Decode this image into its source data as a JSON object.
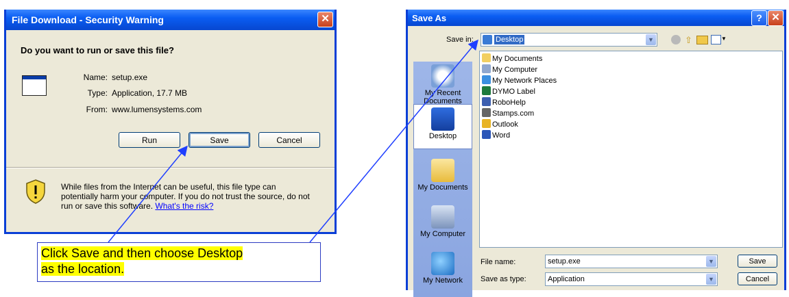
{
  "file_download": {
    "title": "File Download - Security Warning",
    "question": "Do you want to run or save this file?",
    "name_label": "Name:",
    "name_value": "setup.exe",
    "type_label": "Type:",
    "type_value": "Application, 17.7 MB",
    "from_label": "From:",
    "from_value": "www.lumensystems.com",
    "run_button": "Run",
    "save_button": "Save",
    "cancel_button": "Cancel",
    "warning_text_1": "While files from the Internet can be useful, this file type can",
    "warning_text_2": "potentially harm your computer. If you do not trust the source, do not",
    "warning_text_3": "run or save this software.",
    "risk_link": "What's the risk?"
  },
  "callout": {
    "line1": "Click Save and then choose Desktop",
    "line2": "as the location."
  },
  "save_as": {
    "title": "Save As",
    "help_glyph": "?",
    "close_glyph": "X",
    "save_in_label": "Save in:",
    "save_in_value": "Desktop",
    "places": [
      {
        "label": "My Recent\nDocuments",
        "line1": "My Recent",
        "line2": "Documents"
      },
      {
        "label": "Desktop"
      },
      {
        "label": "My Documents"
      },
      {
        "label": "My Computer"
      },
      {
        "label": "My Network"
      }
    ],
    "files": [
      "My Documents",
      "My Computer",
      "My Network Places",
      "DYMO Label",
      "RoboHelp",
      "Stamps.com",
      "Outlook",
      "Word"
    ],
    "file_name_label": "File name:",
    "file_name_value": "setup.exe",
    "save_as_type_label": "Save as type:",
    "save_as_type_value": "Application",
    "save_button": "Save",
    "cancel_button": "Cancel"
  },
  "colors": {
    "title_blue": "#0a5df2",
    "callout_highlight": "#ffff00",
    "arrow_blue": "#1f3fff"
  }
}
